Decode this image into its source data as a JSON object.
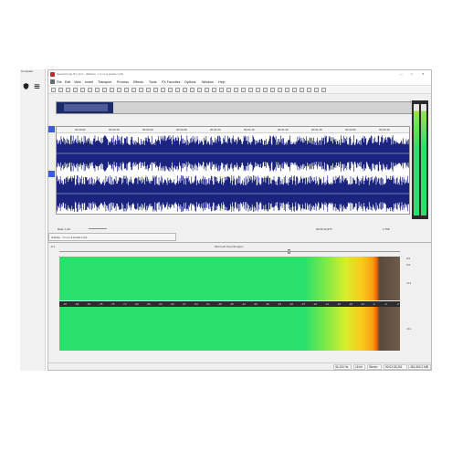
{
  "window": {
    "title": "Sound Forge Pro 11.0 - [HipHop - I'm on a Hustle.mp3]",
    "controls": [
      "—",
      "□",
      "✕"
    ]
  },
  "menu": [
    "File",
    "Edit",
    "View",
    "Insert",
    "Transport",
    "Process",
    "Effects",
    "Tools",
    "FX Favorites",
    "Options",
    "Window",
    "Help"
  ],
  "taskbar_left": {
    "label": "Computer",
    "icons": [
      "shield-icon",
      "hamburger-icon"
    ]
  },
  "ruler_times": [
    "00:00:00",
    "00:00:15",
    "00:00:30",
    "00:00:45",
    "00:01:00",
    "00:01:15",
    "00:01:30",
    "00:01:45",
    "00:02:00",
    "00:02:15"
  ],
  "wave": {
    "db_labels_top": [
      "-2.5",
      "-6",
      "-6",
      "-2.5"
    ],
    "db_labels_bot": [
      "-2.5",
      "-6",
      "-6",
      "-2.5"
    ],
    "channel_count": 2
  },
  "transport": {
    "rate_label": "Rate: 1,00",
    "position": "00:00:12,975",
    "zoom": "1:768"
  },
  "tab": {
    "label": "HipHop - I'm on a Hustle.mp3"
  },
  "spectrum": {
    "title": "Microsoft Soundmapper",
    "left_label": "-0.1",
    "right_labels": [
      "0.0",
      "0.0",
      "-0.1",
      "-0.1"
    ],
    "scale": [
      "-87",
      "-84",
      "-81",
      "-78",
      "-75",
      "-72",
      "-69",
      "-66",
      "-63",
      "-60",
      "-57",
      "-54",
      "-51",
      "-48",
      "-45",
      "-42",
      "-39",
      "-36",
      "-33",
      "-30",
      "-27",
      "-24",
      "-21",
      "-18",
      "-15",
      "-12",
      "-9",
      "-6",
      "-3"
    ]
  },
  "status": {
    "sample_rate": "44,100 Hz",
    "bit_depth": "16 bit",
    "channels": "Stereo",
    "length": "00:02:33,261",
    "size": "451,063.2 MB"
  },
  "colors": {
    "wave": "#1a237e",
    "spectrum_green": "#2be06c",
    "accent_blue": "#3b5bdb"
  }
}
